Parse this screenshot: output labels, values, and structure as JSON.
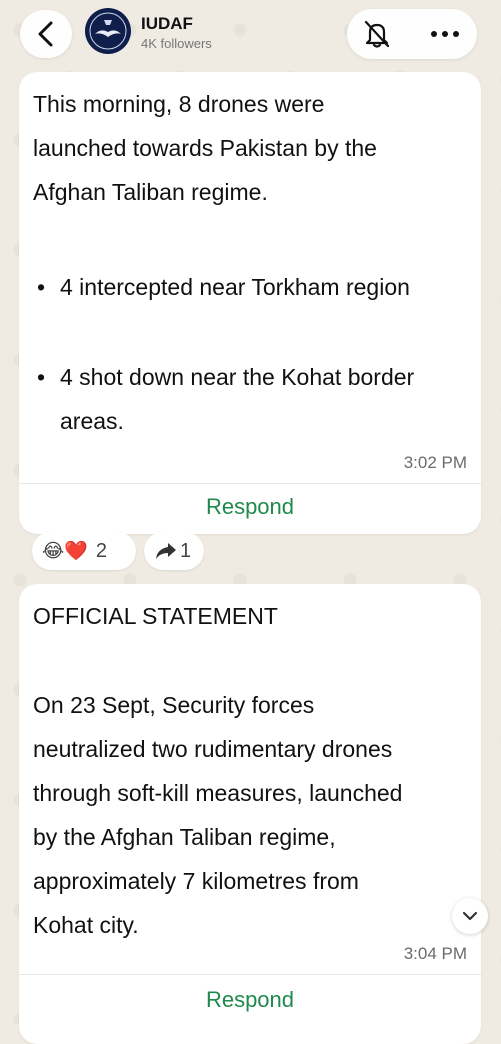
{
  "header": {
    "channel_name": "IUDAF",
    "followers": "4K followers"
  },
  "messages": [
    {
      "intro_lines": [
        "This morning, 8 drones were",
        "launched towards Pakistan by the",
        "Afghan Taliban regime."
      ],
      "bullets": [
        "4 intercepted near Torkham region",
        "4 shot down near the Kohat border areas."
      ],
      "time": "3:02 PM",
      "respond_label": "Respond",
      "reactions": {
        "emojis": "😂❤️",
        "count": "2"
      },
      "forwards": {
        "count": "1"
      }
    },
    {
      "heading": "OFFICIAL STATEMENT",
      "body_lines": [
        "On 23 Sept, Security forces",
        "neutralized two rudimentary drones",
        "through soft-kill measures, launched",
        "by the Afghan Taliban regime,",
        "approximately 7 kilometres from",
        "Kohat city."
      ],
      "time": "3:04 PM",
      "respond_label": "Respond"
    }
  ],
  "colors": {
    "accent": "#1f8a4c",
    "background": "#efeae2"
  }
}
